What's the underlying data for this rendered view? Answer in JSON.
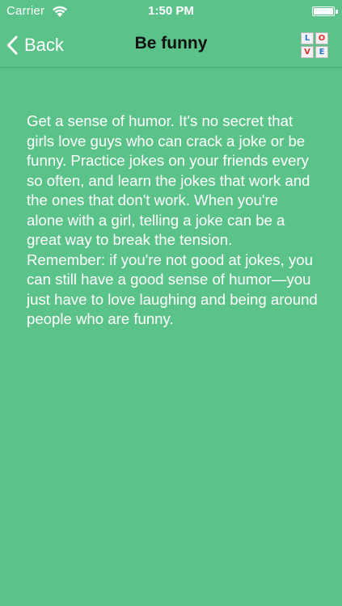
{
  "status_bar": {
    "carrier": "Carrier",
    "time": "1:50 PM",
    "battery_level": 1.0
  },
  "nav": {
    "back_label": "Back",
    "title": "Be funny",
    "love_letters": [
      {
        "letter": "L",
        "color": "#2d7bd6"
      },
      {
        "letter": "O",
        "color": "#e0342c"
      },
      {
        "letter": "V",
        "color": "#e0342c"
      },
      {
        "letter": "E",
        "color": "#2d7bd6"
      }
    ]
  },
  "content": {
    "paragraph_1": "Get a sense of humor. It's no secret that girls love guys who can crack a joke or be funny. Practice jokes on your friends every so often, and learn the jokes that work and the ones that don't work. When you're alone with a girl, telling a joke can be a great way to break the tension.",
    "paragraph_2": "Remember: if you're not good at jokes, you can still have a good sense of humor—you just have to love laughing and being around people who are funny."
  },
  "colors": {
    "background": "#5bc38a",
    "text": "#ffffff",
    "title": "#111111"
  }
}
